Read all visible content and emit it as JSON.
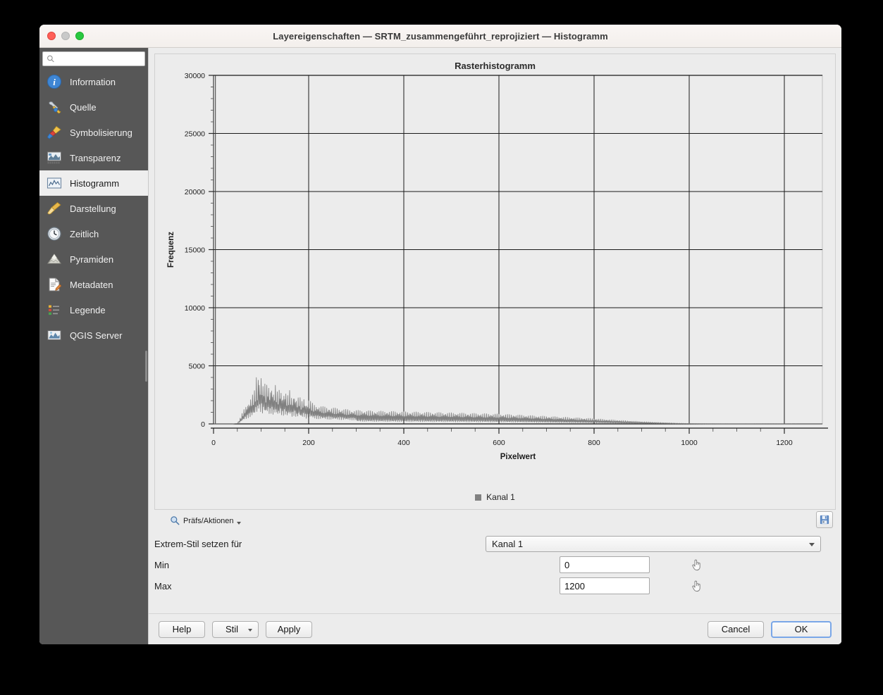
{
  "window": {
    "title": "Layereigenschaften — SRTM_zusammengeführt_reprojiziert — Histogramm"
  },
  "sidebar": {
    "search": {
      "value": "",
      "placeholder": ""
    },
    "items": [
      {
        "label": "Information",
        "icon": "info-icon",
        "selected": false
      },
      {
        "label": "Quelle",
        "icon": "wrench-icon",
        "selected": false
      },
      {
        "label": "Symbolisierung",
        "icon": "brush-icon",
        "selected": false
      },
      {
        "label": "Transparenz",
        "icon": "raster-icon",
        "selected": false
      },
      {
        "label": "Histogramm",
        "icon": "histogram-icon",
        "selected": true
      },
      {
        "label": "Darstellung",
        "icon": "paintbrush-icon",
        "selected": false
      },
      {
        "label": "Zeitlich",
        "icon": "clock-icon",
        "selected": false
      },
      {
        "label": "Pyramiden",
        "icon": "pyramid-icon",
        "selected": false
      },
      {
        "label": "Metadaten",
        "icon": "document-icon",
        "selected": false
      },
      {
        "label": "Legende",
        "icon": "legend-icon",
        "selected": false
      },
      {
        "label": "QGIS Server",
        "icon": "server-icon",
        "selected": false
      }
    ]
  },
  "controls": {
    "prefs_label": "Präfs/Aktionen",
    "save_icon": "floppy-save-icon",
    "extrem_label": "Extrem-Stil setzen für",
    "extrem_value": "Kanal 1",
    "min_label": "Min",
    "min_value": "0",
    "max_label": "Max",
    "max_value": "1200",
    "picker_icon": "hand-pointer-icon"
  },
  "footer": {
    "help": "Help",
    "stil": "Stil",
    "apply": "Apply",
    "cancel": "Cancel",
    "ok": "OK"
  },
  "colors": {
    "sidebar_bg": "#575757",
    "selected_bg": "#eeeeee",
    "plot_bg": "#ececec",
    "series": "#808080",
    "grid": "#1a1a1a",
    "accent": "#7aa7e8"
  },
  "chart_data": {
    "type": "line",
    "title": "Rasterhistogramm",
    "xlabel": "Pixelwert",
    "ylabel": "Frequenz",
    "xlim": [
      0,
      1280
    ],
    "ylim": [
      0,
      30000
    ],
    "xticks": [
      0,
      200,
      400,
      600,
      800,
      1000,
      1200
    ],
    "yticks": [
      0,
      5000,
      10000,
      15000,
      20000,
      25000,
      30000
    ],
    "minor_ticks": true,
    "grid": true,
    "legend": [
      "Kanal 1"
    ],
    "legend_position": "bottom",
    "series": [
      {
        "name": "Kanal 1",
        "color": "#808080",
        "description": "Raster elevation frequency histogram: near-zero below pixel value 50, rising comb-like spikes peaking ~4900 near value 95, decaying through value 300, then a long low oscillating tail (~600-900) fading to zero past value 1000.",
        "x": [
          0,
          20,
          40,
          50,
          55,
          60,
          65,
          70,
          75,
          80,
          85,
          88,
          90,
          92,
          95,
          98,
          100,
          103,
          106,
          110,
          114,
          118,
          122,
          126,
          130,
          135,
          140,
          145,
          150,
          155,
          160,
          165,
          170,
          175,
          180,
          185,
          190,
          195,
          200,
          210,
          220,
          230,
          240,
          250,
          260,
          270,
          280,
          290,
          300,
          320,
          340,
          360,
          380,
          400,
          420,
          440,
          460,
          480,
          500,
          520,
          540,
          560,
          580,
          600,
          620,
          640,
          660,
          680,
          700,
          720,
          740,
          760,
          780,
          800,
          820,
          840,
          860,
          880,
          900,
          920,
          940,
          960,
          980,
          1000,
          1020,
          1060,
          1100,
          1160,
          1220,
          1280
        ],
        "y": [
          0,
          0,
          0,
          60,
          420,
          900,
          1350,
          1700,
          2050,
          2400,
          2750,
          3100,
          4150,
          3000,
          4900,
          3200,
          4500,
          3150,
          3850,
          3050,
          3700,
          2900,
          3500,
          2750,
          3400,
          2600,
          3250,
          2500,
          3000,
          2350,
          2900,
          2200,
          2700,
          2050,
          2500,
          1900,
          2300,
          1750,
          2150,
          1700,
          1600,
          1500,
          1450,
          1400,
          1350,
          1300,
          1250,
          1200,
          1180,
          1150,
          1120,
          1100,
          1080,
          1060,
          1040,
          1020,
          1000,
          980,
          960,
          940,
          920,
          900,
          880,
          860,
          820,
          780,
          740,
          700,
          660,
          620,
          580,
          540,
          500,
          460,
          400,
          350,
          300,
          250,
          200,
          160,
          120,
          90,
          60,
          40,
          25,
          12,
          6,
          3,
          1,
          0
        ]
      }
    ]
  }
}
